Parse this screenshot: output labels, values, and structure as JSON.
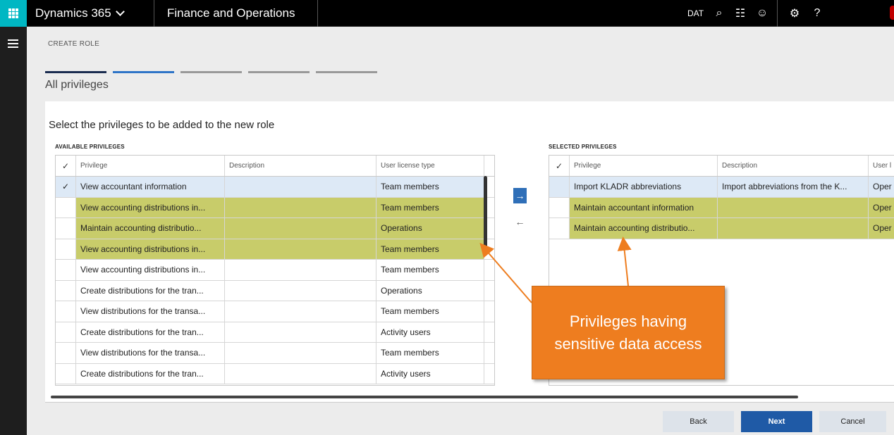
{
  "topbar": {
    "app_name": "Dynamics 365",
    "module": "Finance and Operations",
    "company": "DAT"
  },
  "page": {
    "breadcrumb": "CREATE ROLE",
    "heading": "All privileges",
    "instruction": "Select the privileges to be added to the new role"
  },
  "available": {
    "label": "AVAILABLE PRIVILEGES",
    "columns": [
      "✓",
      "Privilege",
      "Description",
      "User license type"
    ],
    "rows": [
      {
        "check": "✓",
        "privilege": "View accountant information",
        "description": "",
        "license": "Team members"
      },
      {
        "check": "",
        "privilege": "View accounting distributions in...",
        "description": "",
        "license": "Team members"
      },
      {
        "check": "",
        "privilege": "Maintain accounting distributio...",
        "description": "",
        "license": "Operations"
      },
      {
        "check": "",
        "privilege": "View accounting distributions in...",
        "description": "",
        "license": "Team members"
      },
      {
        "check": "",
        "privilege": "View accounting distributions in...",
        "description": "",
        "license": "Team members"
      },
      {
        "check": "",
        "privilege": "Create distributions for the tran...",
        "description": "",
        "license": "Operations"
      },
      {
        "check": "",
        "privilege": "View distributions for the transa...",
        "description": "",
        "license": "Team members"
      },
      {
        "check": "",
        "privilege": "Create distributions for the tran...",
        "description": "",
        "license": "Activity users"
      },
      {
        "check": "",
        "privilege": "View distributions for the transa...",
        "description": "",
        "license": "Team members"
      },
      {
        "check": "",
        "privilege": "Create distributions for the tran...",
        "description": "",
        "license": "Activity users"
      }
    ]
  },
  "selected": {
    "label": "SELECTED PRIVILEGES",
    "columns": [
      "✓",
      "Privilege",
      "Description",
      "User l"
    ],
    "rows": [
      {
        "check": "",
        "privilege": "Import KLADR abbreviations",
        "description": "Import abbreviations from the K...",
        "license": "Oper"
      },
      {
        "check": "",
        "privilege": "Maintain accountant information",
        "description": "",
        "license": "Oper"
      },
      {
        "check": "",
        "privilege": "Maintain accounting distributio...",
        "description": "",
        "license": "Oper"
      }
    ]
  },
  "callout": {
    "text": "Privileges having sensitive data access",
    "color": "#ee7d1f"
  },
  "footer": {
    "back": "Back",
    "next": "Next",
    "cancel": "Cancel"
  },
  "icons": {
    "add": "→",
    "remove": "←",
    "search": "⌕",
    "chat": "☷",
    "smiley": "☺",
    "settings": "⚙",
    "help": "?"
  },
  "colors": {
    "accent": "#2f6fb8",
    "highlight": "#c8cc6a",
    "selected_row": "#dde9f6",
    "waffle": "#00b7c3"
  }
}
